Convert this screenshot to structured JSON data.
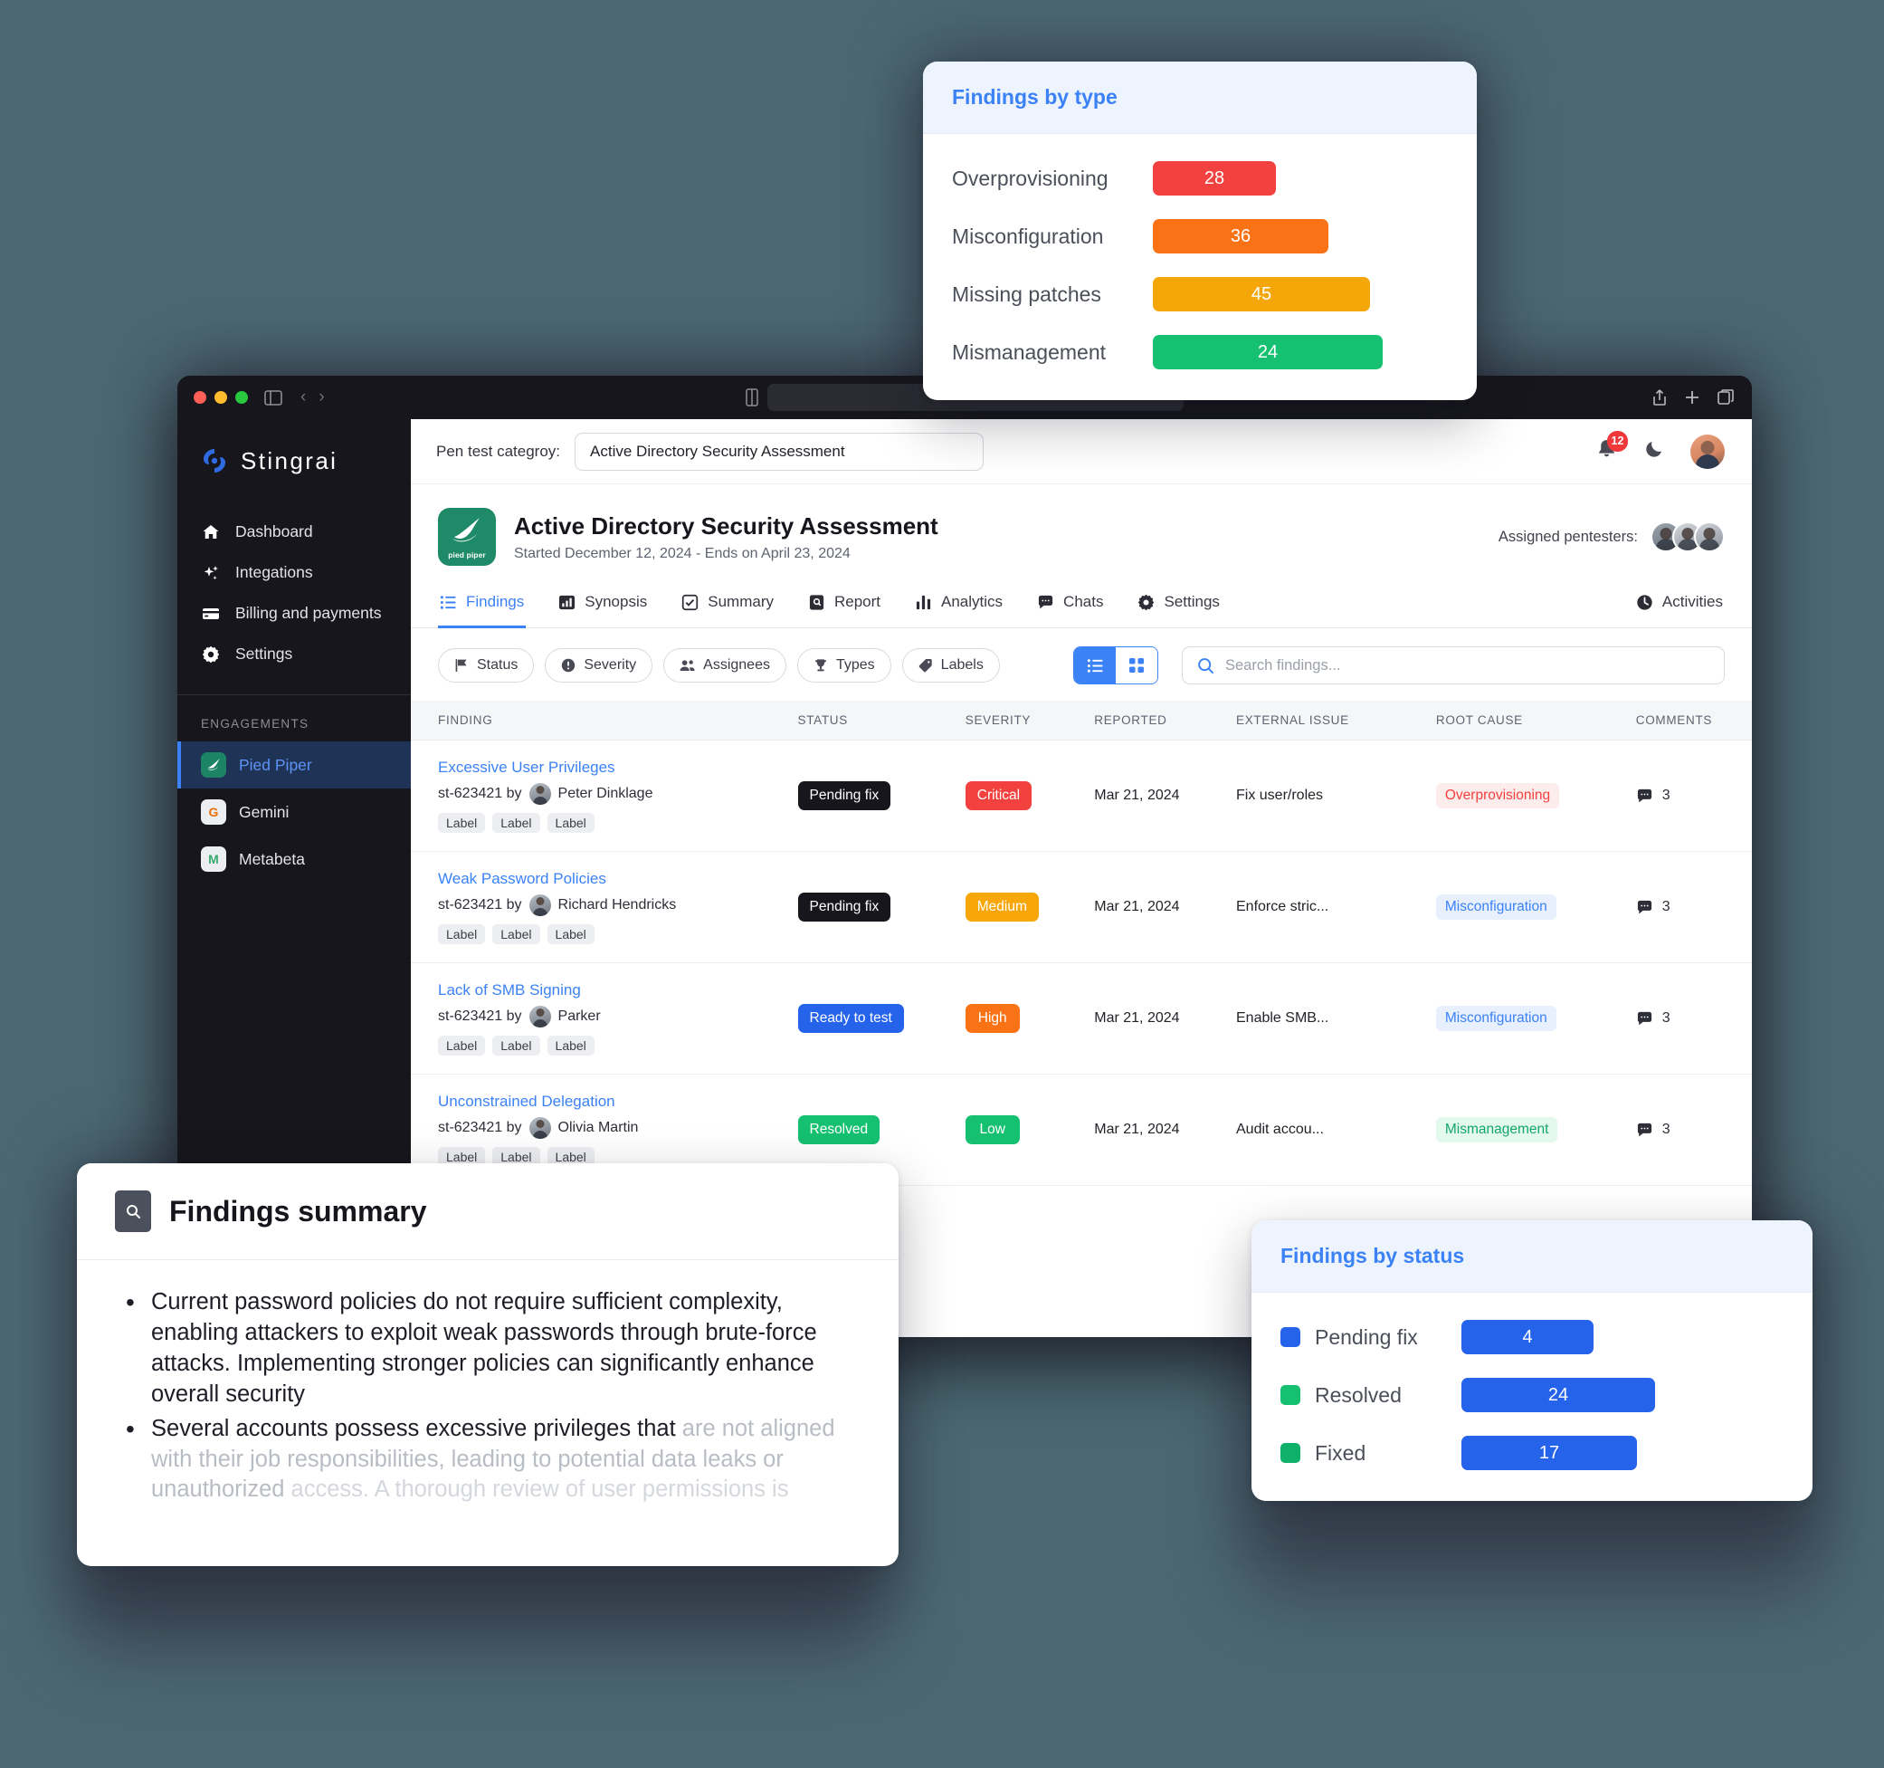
{
  "window": {
    "nav": {
      "back": "‹",
      "forward": "›"
    }
  },
  "sidebar": {
    "brand": "Stingrai",
    "items": [
      {
        "label": "Dashboard",
        "icon": "home-icon"
      },
      {
        "label": "Integations",
        "icon": "sparkles-icon"
      },
      {
        "label": "Billing and payments",
        "icon": "credit-card-icon"
      },
      {
        "label": "Settings",
        "icon": "gear-icon"
      }
    ],
    "section_title": "ENGAGEMENTS",
    "engagements": [
      {
        "label": "Pied Piper",
        "badge": "",
        "active": true
      },
      {
        "label": "Gemini",
        "badge": "G",
        "active": false
      },
      {
        "label": "Metabeta",
        "badge": "M",
        "active": false
      }
    ]
  },
  "topbar": {
    "category_label": "Pen test categroy:",
    "category_value": "Active Directory Security Assessment",
    "notification_count": "12"
  },
  "project": {
    "logo_text": "pied piper",
    "title": "Active Directory Security Assessment",
    "subtitle": "Started December 12, 2024 - Ends on April 23, 2024",
    "pentesters_label": "Assigned pentesters:"
  },
  "tabs": [
    {
      "label": "Findings",
      "icon": "list-icon",
      "active": true
    },
    {
      "label": "Synopsis",
      "icon": "bar-chart-icon",
      "active": false
    },
    {
      "label": "Summary",
      "icon": "check-square-icon",
      "active": false
    },
    {
      "label": "Report",
      "icon": "document-search-icon",
      "active": false
    },
    {
      "label": "Analytics",
      "icon": "analytics-icon",
      "active": false
    },
    {
      "label": "Chats",
      "icon": "chat-icon",
      "active": false
    },
    {
      "label": "Settings",
      "icon": "gear-icon",
      "active": false
    }
  ],
  "tab_right": {
    "label": "Activities",
    "icon": "clock-icon"
  },
  "filters": [
    {
      "label": "Status",
      "icon": "flag-icon"
    },
    {
      "label": "Severity",
      "icon": "alert-icon"
    },
    {
      "label": "Assignees",
      "icon": "users-icon"
    },
    {
      "label": "Types",
      "icon": "trophy-icon"
    },
    {
      "label": "Labels",
      "icon": "tag-icon"
    }
  ],
  "search": {
    "placeholder": "Search findings..."
  },
  "table": {
    "headers": [
      "FINDING",
      "STATUS",
      "SEVERITY",
      "REPORTED",
      "EXTERNAL ISSUE",
      "ROOT CAUSE",
      "COMMENTS"
    ],
    "rows": [
      {
        "title": "Excessive User Privileges",
        "id_prefix": "st-623421 by",
        "author": "Peter Dinklage",
        "labels": [
          "Label",
          "Label",
          "Label"
        ],
        "status": "Pending fix",
        "status_style": "dark",
        "severity": "Critical",
        "severity_style": "critical",
        "reported": "Mar 21, 2024",
        "external_issue": "Fix user/roles",
        "root_cause": "Overprovisioning",
        "root_cause_style": "over",
        "comments": "3"
      },
      {
        "title": "Weak Password Policies",
        "id_prefix": "st-623421 by",
        "author": "Richard Hendricks",
        "labels": [
          "Label",
          "Label",
          "Label"
        ],
        "status": "Pending fix",
        "status_style": "dark",
        "severity": "Medium",
        "severity_style": "medium",
        "reported": "Mar 21, 2024",
        "external_issue": "Enforce stric...",
        "root_cause": "Misconfiguration",
        "root_cause_style": "misc",
        "comments": "3"
      },
      {
        "title": "Lack of SMB Signing",
        "id_prefix": "st-623421 by",
        "author": "Parker",
        "labels": [
          "Label",
          "Label",
          "Label"
        ],
        "status": "Ready to test",
        "status_style": "blue",
        "severity": "High",
        "severity_style": "high",
        "reported": "Mar 21, 2024",
        "external_issue": "Enable SMB...",
        "root_cause": "Misconfiguration",
        "root_cause_style": "misc",
        "comments": "3"
      },
      {
        "title": "Unconstrained Delegation",
        "id_prefix": "st-623421 by",
        "author": "Olivia Martin",
        "labels": [
          "Label",
          "Label",
          "Label"
        ],
        "status": "Resolved",
        "status_style": "green",
        "severity": "Low",
        "severity_style": "low",
        "reported": "Mar 21, 2024",
        "external_issue": "Audit accou...",
        "root_cause": "Mismanagement",
        "root_cause_style": "mism",
        "comments": "3"
      }
    ]
  },
  "findings_summary": {
    "title": "Findings summary",
    "bullets": [
      "Current password policies do not require sufficient complexity, enabling attackers to exploit weak passwords through brute-force attacks. Implementing stronger policies can significantly enhance overall security",
      "Several accounts possess excessive privileges that",
      "are not aligned with their job responsibilities,",
      "leading to potential data leaks or unauthorized",
      "access. A thorough review of user permissions is"
    ]
  },
  "chart_data": [
    {
      "type": "bar",
      "title": "Findings by type",
      "orientation": "horizontal",
      "categories": [
        "Overprovisioning",
        "Misconfiguration",
        "Missing patches",
        "Mismanagement"
      ],
      "values": [
        28,
        36,
        45,
        24
      ],
      "colors": [
        "#f2413f",
        "#f97316",
        "#f5a709",
        "#15c070"
      ],
      "max": 45,
      "xlabel": "",
      "ylabel": "",
      "grid": false,
      "legend": "none"
    },
    {
      "type": "bar",
      "title": "Findings by status",
      "orientation": "horizontal",
      "categories": [
        "Pending fix",
        "Resolved",
        "Fixed"
      ],
      "values": [
        4,
        24,
        17
      ],
      "bar_color": "#2563eb",
      "swatch_colors": [
        "#2563eb",
        "#15c070",
        "#0fb06a"
      ],
      "max": 24,
      "xlabel": "",
      "ylabel": "",
      "grid": false,
      "legend": "none"
    }
  ]
}
